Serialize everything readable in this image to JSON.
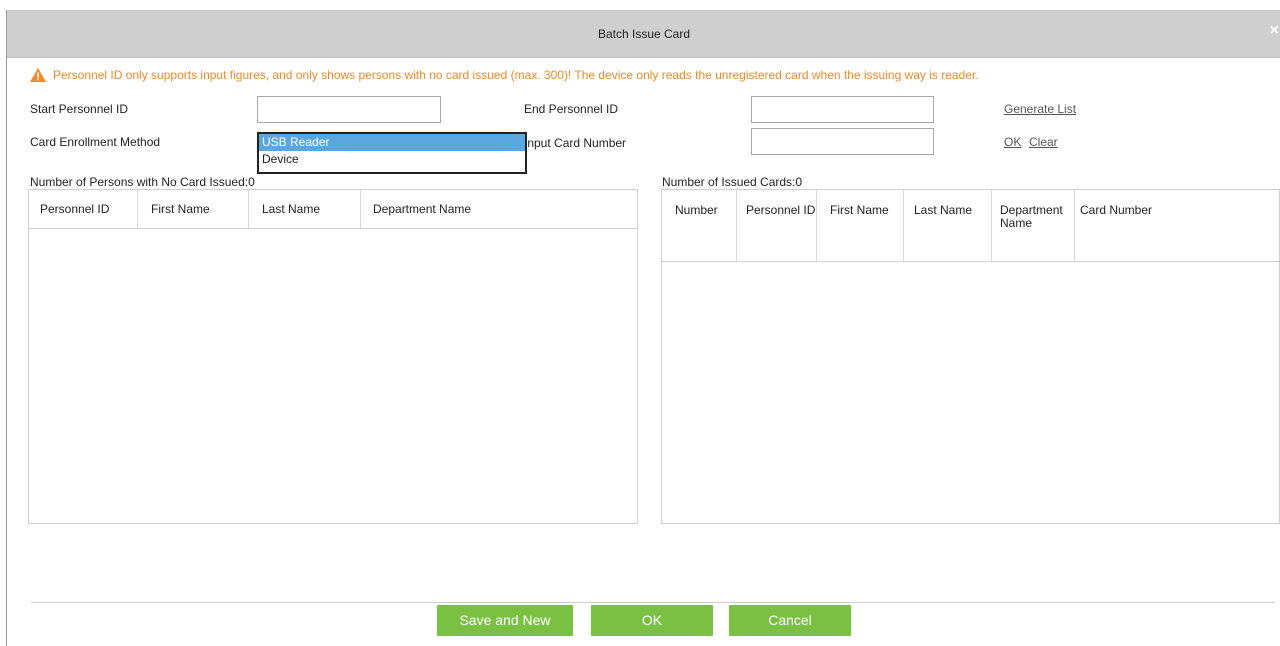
{
  "dialog": {
    "title": "Batch Issue Card",
    "close_label": "×"
  },
  "warning": {
    "text": "Personnel ID only supports input figures, and only shows persons with no card issued (max. 300)! The device only reads the unregistered card when the issuing way is reader.",
    "color": "#f08a2c",
    "icon": "warning-triangle-icon"
  },
  "form": {
    "start_id_label": "Start Personnel ID",
    "start_id_value": "",
    "end_id_label": "End Personnel ID",
    "end_id_value": "",
    "generate_list_label": "Generate List",
    "enroll_method_label": "Card Enrollment Method",
    "enroll_options": [
      "USB Reader",
      "Device"
    ],
    "enroll_selected": "USB Reader",
    "input_card_label": "Input Card Number",
    "input_card_value": "",
    "ok_link_label": "OK",
    "clear_link_label": "Clear"
  },
  "left_table": {
    "title": "Number of Persons with No Card Issued:0",
    "columns": [
      "Personnel ID",
      "First Name",
      "Last Name",
      "Department Name"
    ],
    "rows": []
  },
  "right_table": {
    "title": "Number of Issued Cards:0",
    "columns": [
      "Number",
      "Personnel ID",
      "First Name",
      "Last Name",
      "Department Name",
      "Card Number"
    ],
    "rows": []
  },
  "buttons": {
    "save_new": "Save and New",
    "ok": "OK",
    "cancel": "Cancel",
    "color": "#7ac143"
  }
}
